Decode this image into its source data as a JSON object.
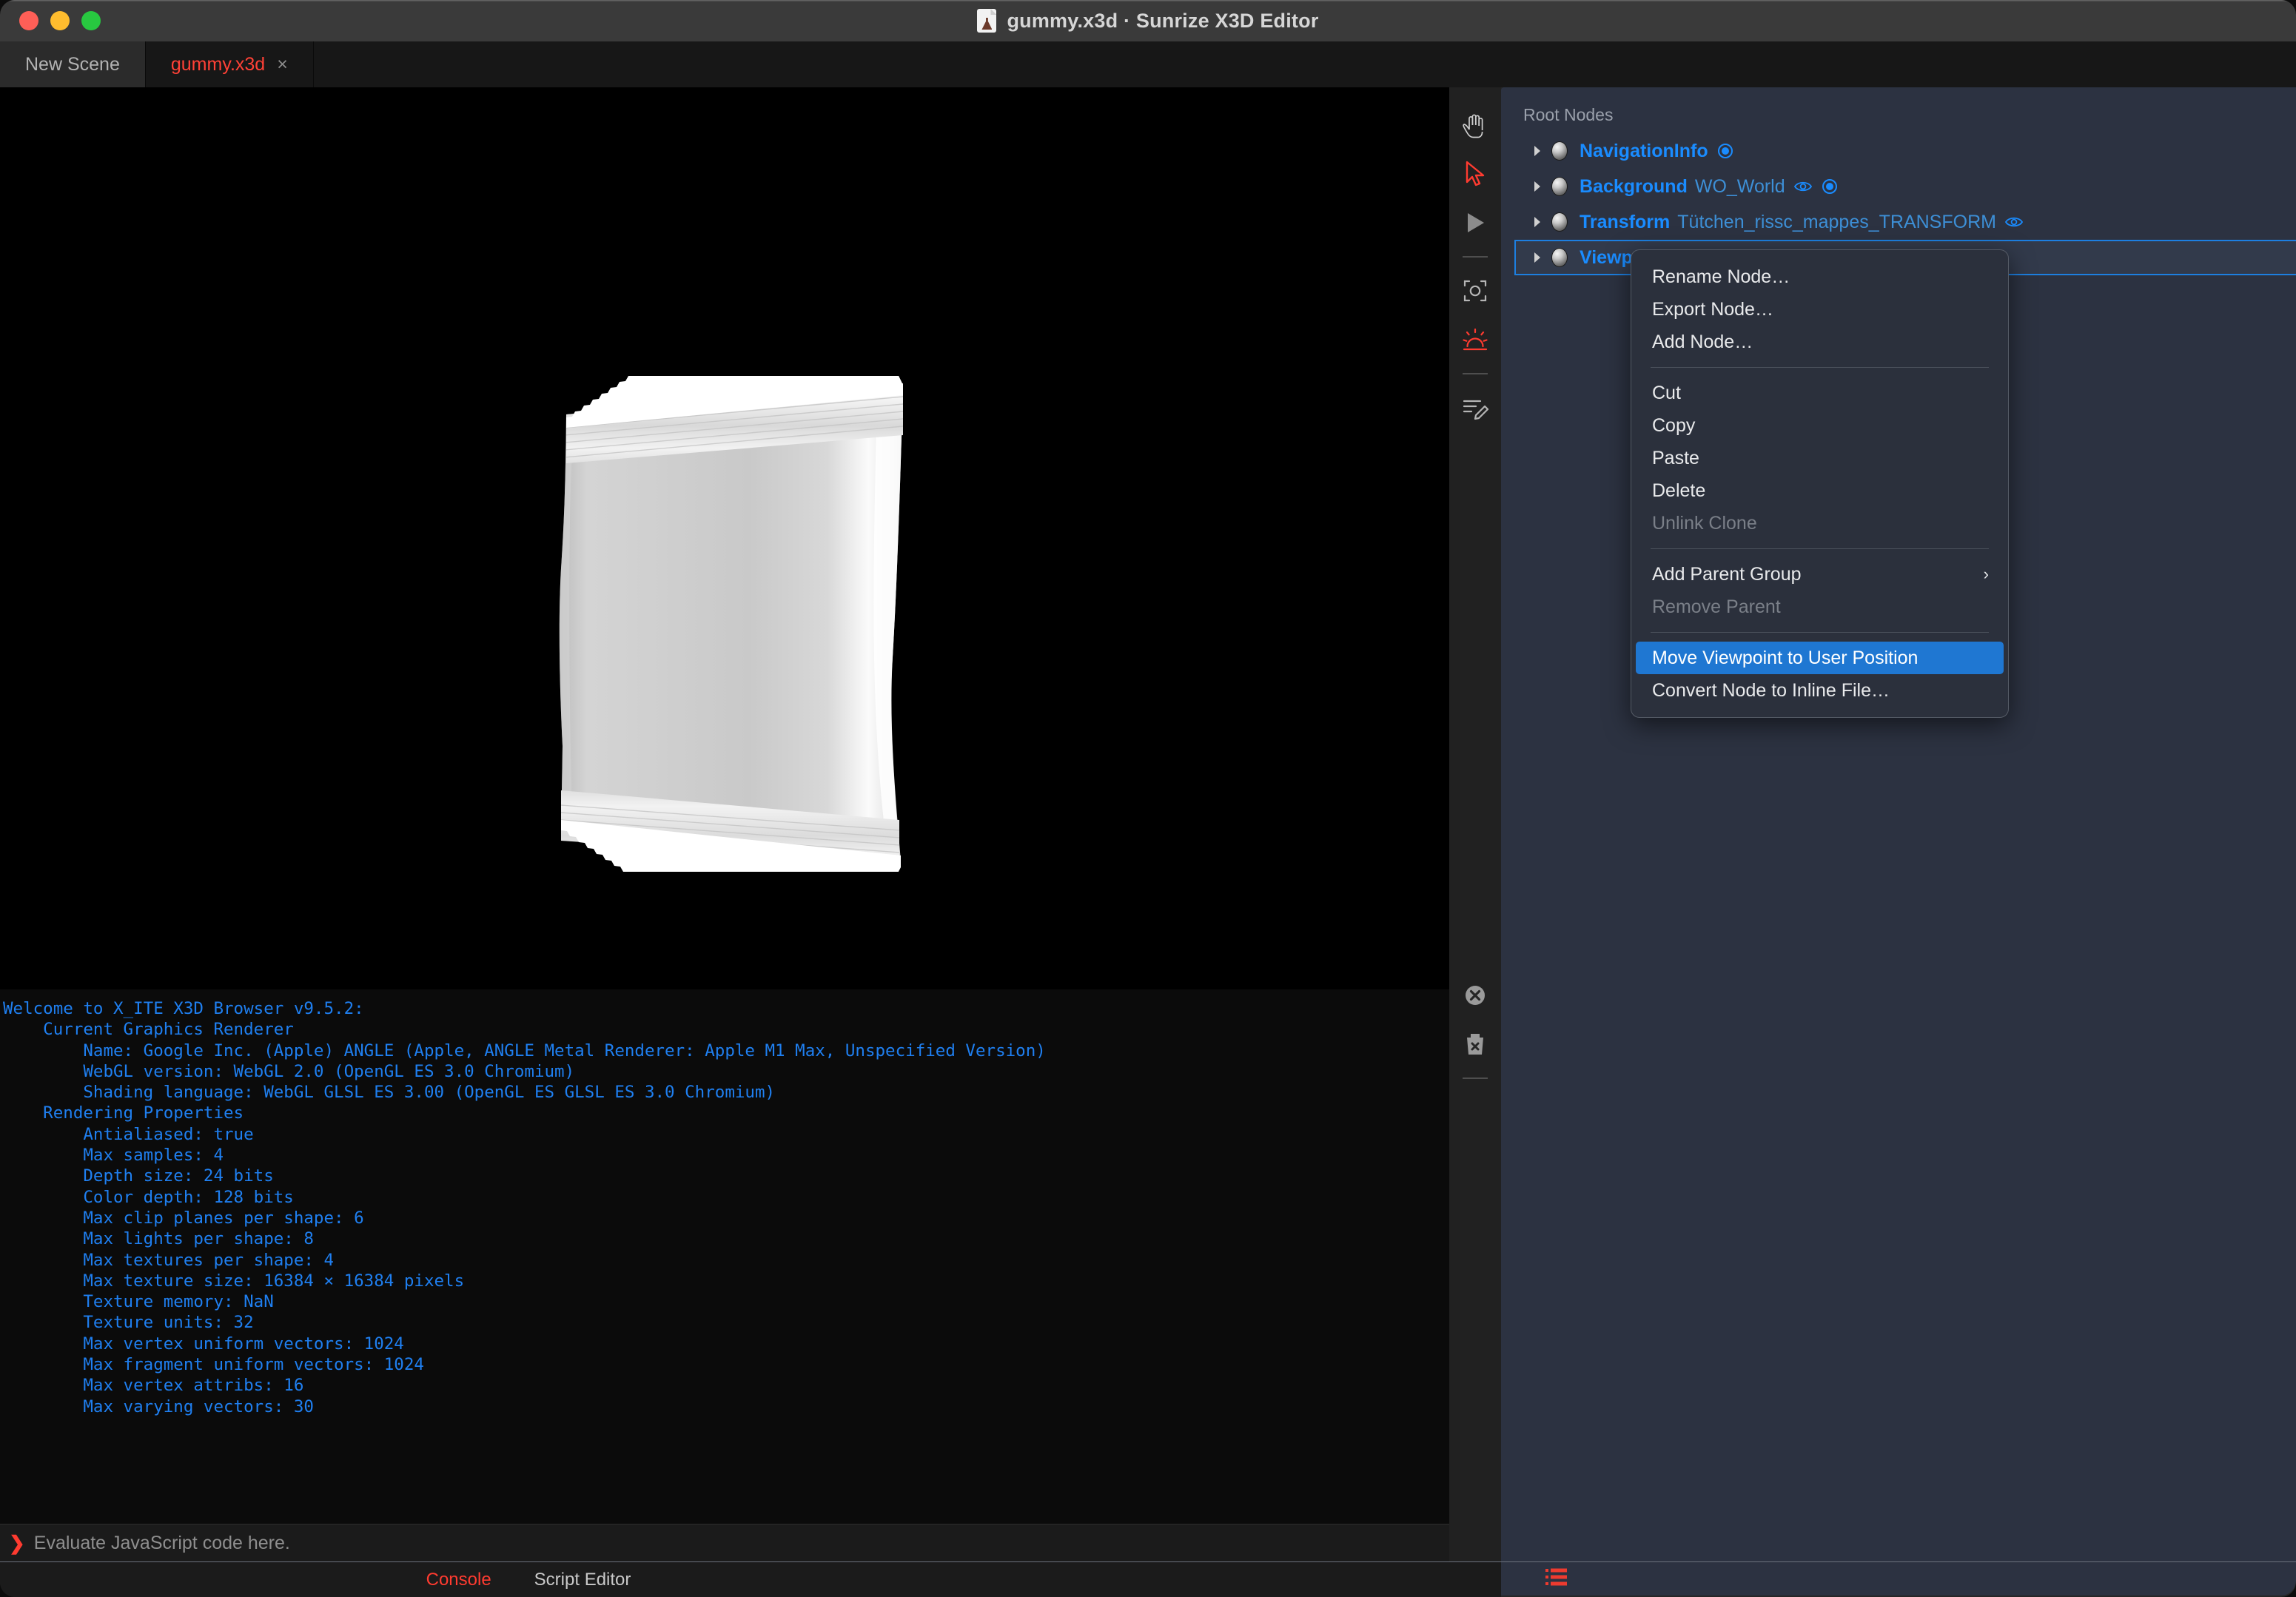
{
  "window": {
    "title": "gummy.x3d · Sunrize X3D Editor",
    "controls": {
      "close": "close",
      "minimize": "minimize",
      "zoom": "zoom"
    },
    "doc_icon": "x3d-document-icon"
  },
  "tabs": [
    {
      "label": "New Scene",
      "active": false,
      "closable": false
    },
    {
      "label": "gummy.x3d",
      "active": true,
      "closable": true,
      "close_label": "×"
    }
  ],
  "toolbar": {
    "items": [
      {
        "name": "hand-tool-icon",
        "active": false
      },
      {
        "name": "arrow-select-tool-icon",
        "active": true
      },
      {
        "name": "play-tool-icon",
        "active": false
      },
      {
        "name": "separator",
        "active": false
      },
      {
        "name": "viewpoint-camera-icon",
        "active": false
      },
      {
        "name": "lighting-sun-icon",
        "active": true
      },
      {
        "name": "separator",
        "active": false
      },
      {
        "name": "edit-lines-pencil-icon",
        "active": false
      }
    ],
    "bottom_items": [
      {
        "name": "clear-console-circle-x-icon"
      },
      {
        "name": "delete-trash-x-icon"
      },
      {
        "name": "separator"
      }
    ]
  },
  "outliner": {
    "header": "Root Nodes",
    "nodes": [
      {
        "type": "NavigationInfo",
        "name": "",
        "selected": false,
        "icons": [
          "radio-icon"
        ]
      },
      {
        "type": "Background",
        "name": "WO_World",
        "selected": false,
        "icons": [
          "eye-icon",
          "radio-icon"
        ]
      },
      {
        "type": "Transform",
        "name": "Tütchen_rissc_mappes_TRANSFORM",
        "selected": false,
        "icons": [
          "eye-icon"
        ]
      },
      {
        "type": "Viewpoint",
        "name": "",
        "selected": true,
        "icons": [
          "eye-icon",
          "radio-icon"
        ]
      }
    ],
    "footer_icon": "red-list-icon"
  },
  "context_menu": {
    "items": [
      {
        "label": "Rename Node…",
        "kind": "item"
      },
      {
        "label": "Export Node…",
        "kind": "item"
      },
      {
        "label": "Add Node…",
        "kind": "item"
      },
      {
        "kind": "separator"
      },
      {
        "label": "Cut",
        "kind": "item"
      },
      {
        "label": "Copy",
        "kind": "item"
      },
      {
        "label": "Paste",
        "kind": "item"
      },
      {
        "label": "Delete",
        "kind": "item"
      },
      {
        "label": "Unlink Clone",
        "kind": "disabled"
      },
      {
        "kind": "separator"
      },
      {
        "label": "Add Parent Group",
        "kind": "submenu",
        "chevron": "›"
      },
      {
        "label": "Remove Parent",
        "kind": "disabled"
      },
      {
        "kind": "separator"
      },
      {
        "label": "Move Viewpoint to User Position",
        "kind": "highlight"
      },
      {
        "label": "Convert Node to Inline File…",
        "kind": "item"
      }
    ]
  },
  "console": {
    "text": "Welcome to X_ITE X3D Browser v9.5.2:\n    Current Graphics Renderer\n        Name: Google Inc. (Apple) ANGLE (Apple, ANGLE Metal Renderer: Apple M1 Max, Unspecified Version)\n        WebGL version: WebGL 2.0 (OpenGL ES 3.0 Chromium)\n        Shading language: WebGL GLSL ES 3.00 (OpenGL ES GLSL ES 3.0 Chromium)\n    Rendering Properties\n        Antialiased: true\n        Max samples: 4\n        Depth size: 24 bits\n        Color depth: 128 bits\n        Max clip planes per shape: 6\n        Max lights per shape: 8\n        Max textures per shape: 4\n        Max texture size: 16384 × 16384 pixels\n        Texture memory: NaN\n        Texture units: 32\n        Max vertex uniform vectors: 1024\n        Max fragment uniform vectors: 1024\n        Max vertex attribs: 16\n        Max varying vectors: 30"
  },
  "eval_bar": {
    "prompt": "❯",
    "placeholder": "Evaluate JavaScript code here.",
    "value": ""
  },
  "bottom_tabs": [
    {
      "label": "Console",
      "active": true
    },
    {
      "label": "Script Editor",
      "active": false
    }
  ],
  "colors": {
    "accent_red": "#ff3b30",
    "node_blue": "#1a8cff",
    "selection_blue": "#1f77d2",
    "panel_bg": "#2c3241",
    "menu_bg": "#2b303c"
  },
  "viewport": {
    "object_name": "candy-wrapper-sachet-3d-model"
  }
}
